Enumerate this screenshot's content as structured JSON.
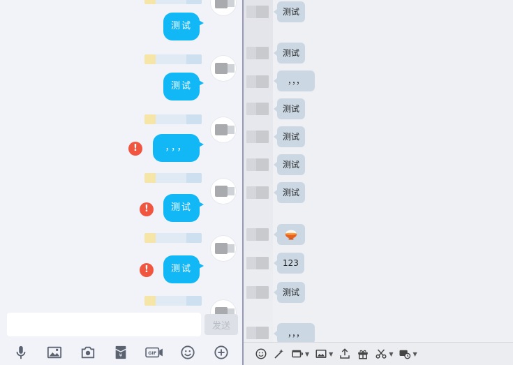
{
  "left": {
    "messages": [
      {
        "text": "测试",
        "error": false
      },
      {
        "text": "测试",
        "error": false
      },
      {
        "text": "，，，",
        "error": true
      },
      {
        "text": "测试",
        "error": true
      },
      {
        "text": "测试",
        "error": true
      }
    ],
    "error_mark": "!",
    "input": {
      "value": "",
      "placeholder": ""
    },
    "send_label": "发送",
    "tools": [
      "microphone-icon",
      "image-icon",
      "camera-icon",
      "red-envelope-icon",
      "gif-icon",
      "emoji-icon",
      "plus-icon"
    ],
    "gif_text": "GIF",
    "yen_text": "¥"
  },
  "right": {
    "messages": [
      {
        "text": "测试"
      },
      {
        "text": "测试"
      },
      {
        "text": "，，，"
      },
      {
        "text": "测试"
      },
      {
        "text": "测试"
      },
      {
        "text": "测试"
      },
      {
        "text": "测试"
      },
      {
        "text": ""
      },
      {
        "text": "123"
      },
      {
        "text": "测试"
      },
      {
        "text": "，，，"
      }
    ],
    "toolbar": [
      "font-icon",
      "emoji-icon",
      "magic-wand-icon",
      "window-shake-icon",
      "image-icon",
      "upload-icon",
      "gift-icon",
      "scissors-icon",
      "chat-record-icon"
    ]
  },
  "colors": {
    "bubble_blue": "#12b7f5",
    "bubble_gray": "#cbd8e4",
    "error_red": "#f2553f"
  }
}
